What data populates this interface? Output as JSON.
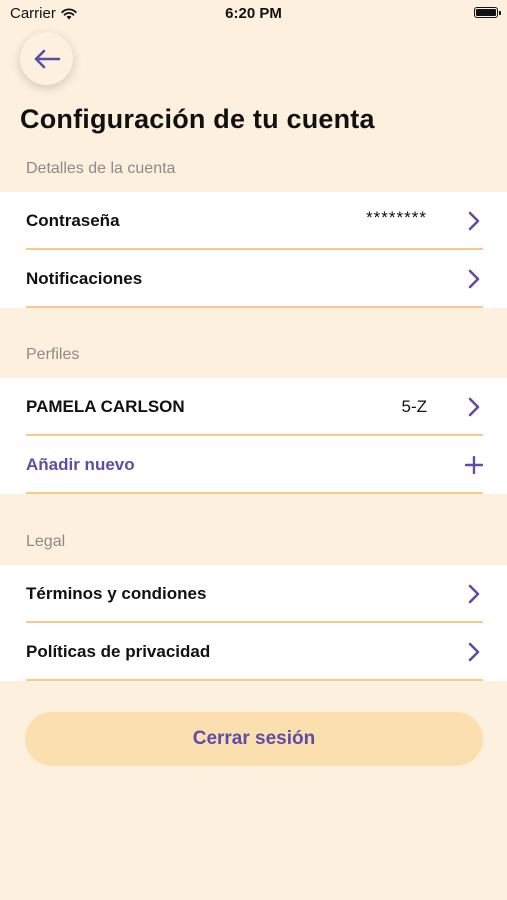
{
  "status_bar": {
    "carrier": "Carrier",
    "time": "6:20 PM"
  },
  "header": {
    "back_icon": "arrow-left-icon",
    "title": "Configuración de tu cuenta"
  },
  "account_details": {
    "section_label": "Detalles de la cuenta",
    "password": {
      "label": "Contraseña",
      "value": "********"
    },
    "notifications": {
      "label": "Notificaciones"
    }
  },
  "profiles": {
    "section_label": "Perfiles",
    "items": [
      {
        "name": "PAMELA CARLSON",
        "value": "5-Z"
      }
    ],
    "add_new_label": "Añadir nuevo"
  },
  "legal": {
    "section_label": "Legal",
    "terms_label": "Términos y condiones",
    "privacy_label": "Políticas de privacidad"
  },
  "logout_label": "Cerrar sesión",
  "colors": {
    "background": "#fdf0de",
    "accent": "#5b4ea6",
    "divider": "#f7c98b",
    "logout_button": "#fbdfae"
  }
}
